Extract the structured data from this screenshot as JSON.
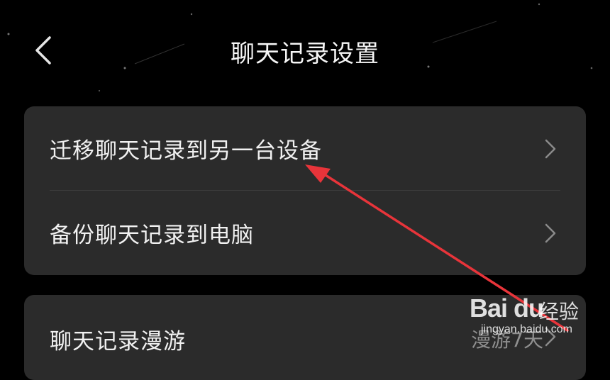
{
  "header": {
    "title": "聊天记录设置",
    "back_icon": "chevron-left-icon"
  },
  "settings_card_1": {
    "items": [
      {
        "label": "迁移聊天记录到另一台设备"
      },
      {
        "label": "备份聊天记录到电脑"
      }
    ]
  },
  "settings_card_2": {
    "items": [
      {
        "label": "聊天记录漫游",
        "value": "漫游7天"
      }
    ]
  },
  "watermark": {
    "logo": "Bai du",
    "text": "经验",
    "url": "jingyan.baidu.com"
  },
  "colors": {
    "background": "#000000",
    "card": "#2b2b2b",
    "annotation_arrow": "#e8343a"
  }
}
